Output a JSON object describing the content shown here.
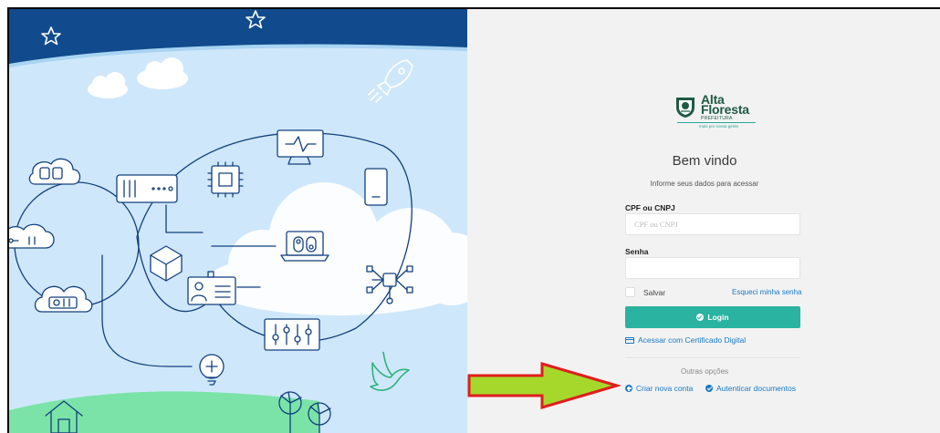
{
  "brand": {
    "line1": "Alta",
    "line2": "Floresta",
    "sub": "PREFEITURA",
    "tagline": "mais por nossa gente"
  },
  "login": {
    "title": "Bem vindo",
    "subtitle": "Informe seus dados para acessar",
    "cpf_label": "CPF ou CNPJ",
    "cpf_placeholder": "CPF ou CNPJ",
    "cpf_value": "",
    "password_label": "Senha",
    "password_value": "",
    "remember_label": "Salvar",
    "remember_checked": false,
    "forgot_label": "Esqueci minha senha",
    "login_button": "Login",
    "certificate_link": "Acessar com Certificado Digital",
    "other_options_label": "Outras opções",
    "create_account": "Criar nova conta",
    "authenticate_documents": "Autenticar documentos"
  },
  "colors": {
    "sky_dark": "#114b8e",
    "sky_light": "#cfe7fa",
    "line": "#12407e",
    "primary_button": "#2ab3a0",
    "link": "#1a79c6",
    "panel_bg": "#f2f2f2",
    "annotation_arrow_fill": "#a5d82b",
    "annotation_arrow_stroke": "#e01e1e"
  },
  "icons": [
    "star-icon",
    "cloud-icon",
    "rocket-icon",
    "monitor-icon",
    "phone-icon",
    "chip-icon",
    "server-icon",
    "cloud-device-icon",
    "cube-icon",
    "id-card-icon",
    "laptop-icon",
    "network-icon",
    "mixer-icon",
    "lightbulb-icon",
    "house-icon",
    "wind-turbine-icon",
    "bird-icon",
    "credit-card-icon",
    "check-circle-icon",
    "plus-circle-icon"
  ]
}
